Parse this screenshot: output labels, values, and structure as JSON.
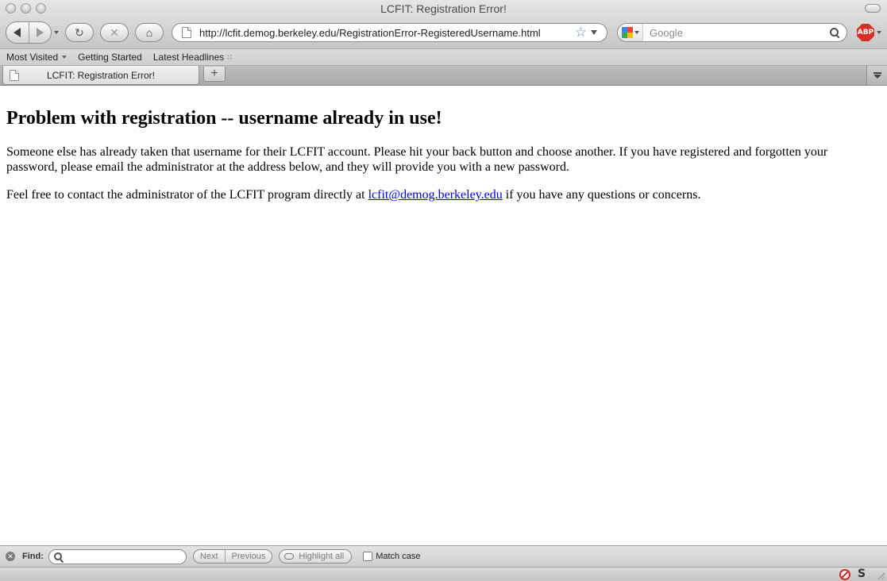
{
  "window": {
    "title": "LCFIT: Registration Error!"
  },
  "toolbar": {
    "url": "http://lcfit.demog.berkeley.edu/RegistrationError-RegisteredUsername.html",
    "search_placeholder": "Google",
    "adblock_label": "ABP"
  },
  "bookmarks": {
    "items": [
      {
        "label": "Most Visited"
      },
      {
        "label": "Getting Started"
      },
      {
        "label": "Latest Headlines"
      }
    ]
  },
  "tabs": [
    {
      "label": "LCFIT: Registration Error!"
    }
  ],
  "page": {
    "heading": "Problem with registration -- username already in use!",
    "paragraph1": "Someone else has already taken that username for their LCFIT account. Please hit your back button and choose another. If you have registered and forgotten your password, please email the administrator at the address below, and they will provide you with a new password.",
    "paragraph2_before": "Feel free to contact the administrator of the LCFIT program directly at ",
    "email": "lcfit@demog.berkeley.edu",
    "paragraph2_after": " if you have any questions or concerns."
  },
  "findbar": {
    "label": "Find:",
    "next_label": "Next",
    "previous_label": "Previous",
    "highlight_label": "Highlight all",
    "match_case_label": "Match case"
  },
  "statusbar": {
    "s_icon": "S"
  },
  "colors": {
    "link": "#0000ee",
    "adblock": "#d62f26"
  }
}
